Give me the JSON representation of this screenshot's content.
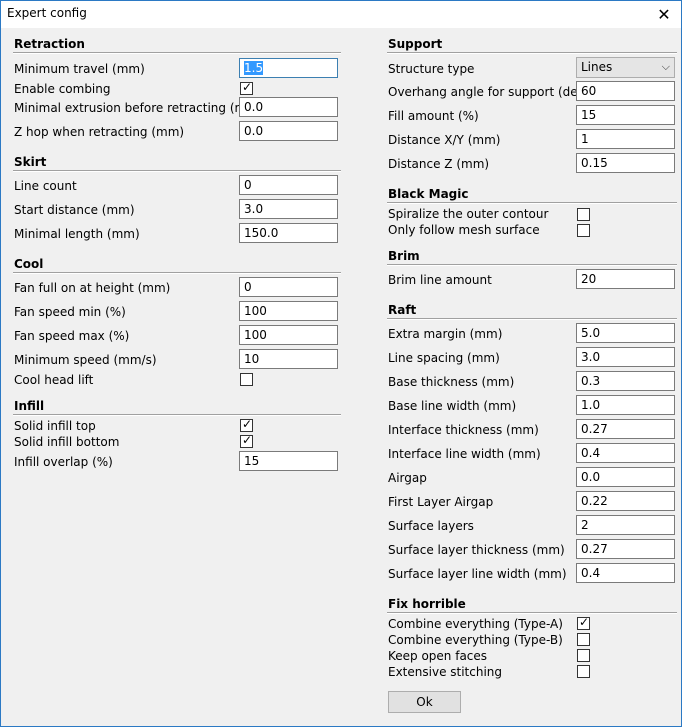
{
  "window": {
    "title": "Expert config",
    "close_glyph": "✕"
  },
  "left": {
    "retraction": {
      "title": "Retraction",
      "min_travel": {
        "label": "Minimum travel (mm)",
        "value": "1.5"
      },
      "enable_combing": {
        "label": "Enable combing",
        "checked": true
      },
      "min_extrusion": {
        "label": "Minimal extrusion before retracting (mm)",
        "value": "0.0"
      },
      "z_hop": {
        "label": "Z hop when retracting (mm)",
        "value": "0.0"
      }
    },
    "skirt": {
      "title": "Skirt",
      "line_count": {
        "label": "Line count",
        "value": "0"
      },
      "start_distance": {
        "label": "Start distance (mm)",
        "value": "3.0"
      },
      "minimal_length": {
        "label": "Minimal length (mm)",
        "value": "150.0"
      }
    },
    "cool": {
      "title": "Cool",
      "fan_full_height": {
        "label": "Fan full on at height (mm)",
        "value": "0"
      },
      "fan_speed_min": {
        "label": "Fan speed min (%)",
        "value": "100"
      },
      "fan_speed_max": {
        "label": "Fan speed max (%)",
        "value": "100"
      },
      "minimum_speed": {
        "label": "Minimum speed (mm/s)",
        "value": "10"
      },
      "cool_head_lift": {
        "label": "Cool head lift",
        "checked": false
      }
    },
    "infill": {
      "title": "Infill",
      "solid_top": {
        "label": "Solid infill top",
        "checked": true
      },
      "solid_bottom": {
        "label": "Solid infill bottom",
        "checked": true
      },
      "overlap": {
        "label": "Infill overlap (%)",
        "value": "15"
      }
    }
  },
  "right": {
    "support": {
      "title": "Support",
      "structure_type": {
        "label": "Structure type",
        "value": "Lines"
      },
      "overhang_angle": {
        "label": "Overhang angle for support (deg)",
        "value": "60"
      },
      "fill_amount": {
        "label": "Fill amount (%)",
        "value": "15"
      },
      "distance_xy": {
        "label": "Distance X/Y (mm)",
        "value": "1"
      },
      "distance_z": {
        "label": "Distance Z (mm)",
        "value": "0.15"
      }
    },
    "black_magic": {
      "title": "Black Magic",
      "spiralize": {
        "label": "Spiralize the outer contour",
        "checked": false
      },
      "mesh_surface": {
        "label": "Only follow mesh surface",
        "checked": false
      }
    },
    "brim": {
      "title": "Brim",
      "line_amount": {
        "label": "Brim line amount",
        "value": "20"
      }
    },
    "raft": {
      "title": "Raft",
      "extra_margin": {
        "label": "Extra margin (mm)",
        "value": "5.0"
      },
      "line_spacing": {
        "label": "Line spacing (mm)",
        "value": "3.0"
      },
      "base_thickness": {
        "label": "Base thickness (mm)",
        "value": "0.3"
      },
      "base_line_width": {
        "label": "Base line width (mm)",
        "value": "1.0"
      },
      "interface_thickness": {
        "label": "Interface thickness (mm)",
        "value": "0.27"
      },
      "interface_line_width": {
        "label": "Interface line width (mm)",
        "value": "0.4"
      },
      "airgap": {
        "label": "Airgap",
        "value": "0.0"
      },
      "first_layer_airgap": {
        "label": "First Layer Airgap",
        "value": "0.22"
      },
      "surface_layers": {
        "label": "Surface layers",
        "value": "2"
      },
      "surface_layer_thickness": {
        "label": "Surface layer thickness (mm)",
        "value": "0.27"
      },
      "surface_layer_line_width": {
        "label": "Surface layer line width (mm)",
        "value": "0.4"
      }
    },
    "fix_horrible": {
      "title": "Fix horrible",
      "type_a": {
        "label": "Combine everything (Type-A)",
        "checked": true
      },
      "type_b": {
        "label": "Combine everything (Type-B)",
        "checked": false
      },
      "open_faces": {
        "label": "Keep open faces",
        "checked": false
      },
      "stitching": {
        "label": "Extensive stitching",
        "checked": false
      }
    }
  },
  "buttons": {
    "ok": "Ok"
  },
  "icons": {
    "check": "✓",
    "dropdown": "⌵"
  }
}
